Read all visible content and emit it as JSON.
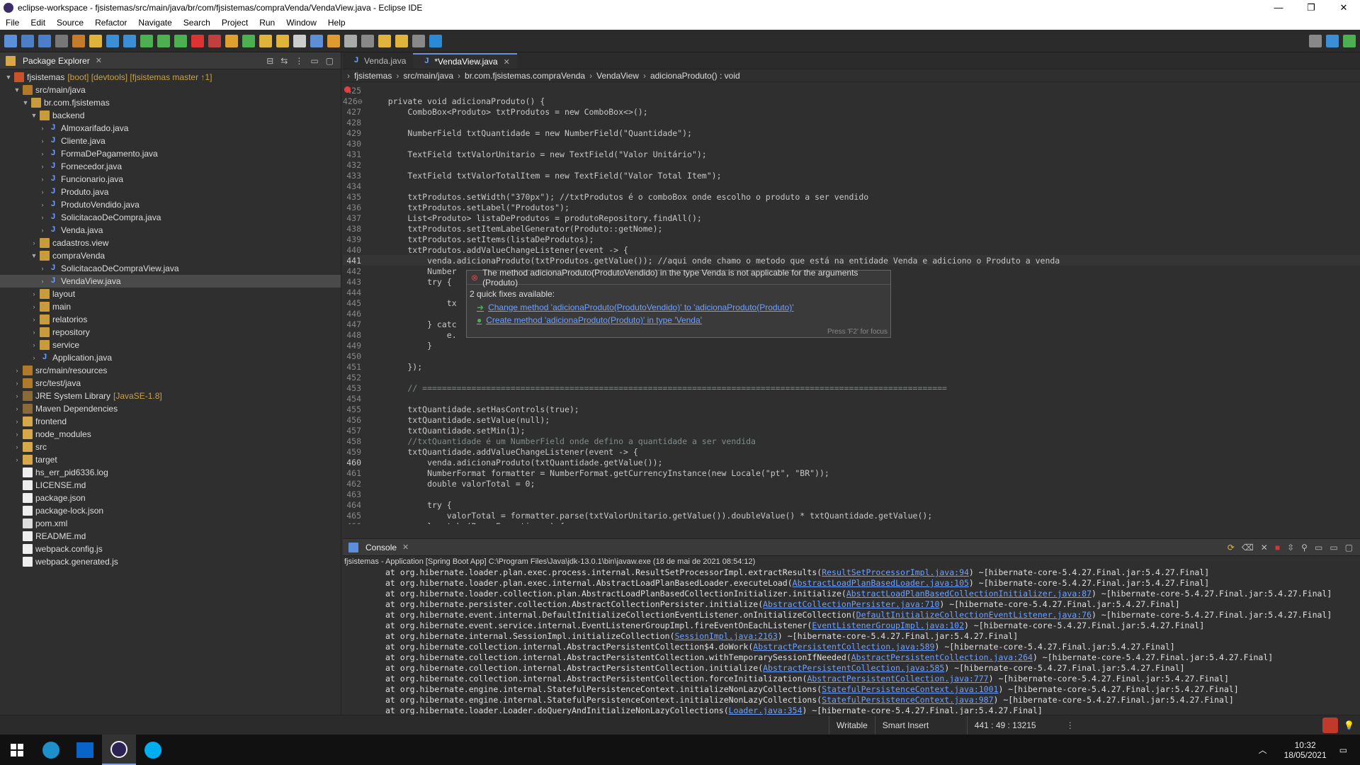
{
  "window": {
    "title": "eclipse-workspace - fjsistemas/src/main/java/br/com/fjsistemas/compraVenda/VendaView.java - Eclipse IDE",
    "minimize": "—",
    "maximize": "❐",
    "close": "✕"
  },
  "menu": [
    "File",
    "Edit",
    "Source",
    "Refactor",
    "Navigate",
    "Search",
    "Project",
    "Run",
    "Window",
    "Help"
  ],
  "explorer": {
    "title": "Package Explorer",
    "items": [
      {
        "label": "fjsistemas",
        "deco": "[boot] [devtools] [fjsistemas master ↑1]"
      },
      {
        "label": "src/main/java"
      },
      {
        "label": "br.com.fjsistemas"
      },
      {
        "label": "backend"
      },
      {
        "label": "Almoxarifado.java"
      },
      {
        "label": "Cliente.java"
      },
      {
        "label": "FormaDePagamento.java"
      },
      {
        "label": "Fornecedor.java"
      },
      {
        "label": "Funcionario.java"
      },
      {
        "label": "Produto.java"
      },
      {
        "label": "ProdutoVendido.java"
      },
      {
        "label": "SolicitacaoDeCompra.java"
      },
      {
        "label": "Venda.java"
      },
      {
        "label": "cadastros.view"
      },
      {
        "label": "compraVenda"
      },
      {
        "label": "SolicitacaoDeCompraView.java"
      },
      {
        "label": "VendaView.java"
      },
      {
        "label": "layout"
      },
      {
        "label": "main"
      },
      {
        "label": "relatorios"
      },
      {
        "label": "repository"
      },
      {
        "label": "service"
      },
      {
        "label": "Application.java"
      },
      {
        "label": "src/main/resources"
      },
      {
        "label": "src/test/java"
      },
      {
        "label": "JRE System Library",
        "deco": "[JavaSE-1.8]"
      },
      {
        "label": "Maven Dependencies"
      },
      {
        "label": "frontend"
      },
      {
        "label": "node_modules"
      },
      {
        "label": "src"
      },
      {
        "label": "target"
      },
      {
        "label": "hs_err_pid6336.log"
      },
      {
        "label": "LICENSE.md"
      },
      {
        "label": "package.json"
      },
      {
        "label": "package-lock.json"
      },
      {
        "label": "pom.xml"
      },
      {
        "label": "README.md"
      },
      {
        "label": "webpack.config.js"
      },
      {
        "label": "webpack.generated.js"
      }
    ]
  },
  "editor": {
    "tabs": [
      {
        "label": "Venda.java"
      },
      {
        "label": "*VendaView.java"
      }
    ],
    "breadcrumb": [
      "fjsistemas",
      "src/main/java",
      "br.com.fjsistemas.compraVenda",
      "VendaView",
      "adicionaProduto() : void"
    ],
    "lines": [
      {
        "n": "425",
        "t": ""
      },
      {
        "n": "426⊖",
        "t": "    private void adicionaProduto() {"
      },
      {
        "n": "427",
        "t": "        ComboBox<Produto> txtProdutos = new ComboBox<>();"
      },
      {
        "n": "428",
        "t": ""
      },
      {
        "n": "429",
        "t": "        NumberField txtQuantidade = new NumberField(\"Quantidade\");"
      },
      {
        "n": "430",
        "t": ""
      },
      {
        "n": "431",
        "t": "        TextField txtValorUnitario = new TextField(\"Valor Unitário\");"
      },
      {
        "n": "432",
        "t": ""
      },
      {
        "n": "433",
        "t": "        TextField txtValorTotalItem = new TextField(\"Valor Total Item\");"
      },
      {
        "n": "434",
        "t": ""
      },
      {
        "n": "435",
        "t": "        txtProdutos.setWidth(\"370px\"); //txtProdutos é o comboBox onde escolho o produto a ser vendido"
      },
      {
        "n": "436",
        "t": "        txtProdutos.setLabel(\"Produtos\");"
      },
      {
        "n": "437",
        "t": "        List<Produto> listaDeProdutos = produtoRepository.findAll();"
      },
      {
        "n": "438",
        "t": "        txtProdutos.setItemLabelGenerator(Produto::getNome);"
      },
      {
        "n": "439",
        "t": "        txtProdutos.setItems(listaDeProdutos);"
      },
      {
        "n": "440",
        "t": "        txtProdutos.addValueChangeListener(event -> {"
      },
      {
        "n": "441",
        "t": "            venda.adicionaProduto(txtProdutos.getValue()); //aqui onde chamo o metodo que está na entidade Venda e adiciono o Produto a venda",
        "err": true
      },
      {
        "n": "442",
        "t": "            Number"
      },
      {
        "n": "443",
        "t": "            try {"
      },
      {
        "n": "444",
        "t": ""
      },
      {
        "n": "445",
        "t": "                tx"
      },
      {
        "n": "446",
        "t": ""
      },
      {
        "n": "447",
        "t": "            } catc"
      },
      {
        "n": "448",
        "t": "                e."
      },
      {
        "n": "449",
        "t": "            }"
      },
      {
        "n": "450",
        "t": ""
      },
      {
        "n": "451",
        "t": "        });"
      },
      {
        "n": "452",
        "t": ""
      },
      {
        "n": "453",
        "t": "        // ==========================================================================================================="
      },
      {
        "n": "454",
        "t": ""
      },
      {
        "n": "455",
        "t": "        txtQuantidade.setHasControls(true);"
      },
      {
        "n": "456",
        "t": "        txtQuantidade.setValue(null);"
      },
      {
        "n": "457",
        "t": "        txtQuantidade.setMin(1);"
      },
      {
        "n": "458",
        "t": "        //txtQuantidade é um NumberField onde defino a quantidade a ser vendida"
      },
      {
        "n": "459",
        "t": "        txtQuantidade.addValueChangeListener(event -> {"
      },
      {
        "n": "460",
        "t": "            venda.adicionaProduto(txtQuantidade.getValue());",
        "err": true
      },
      {
        "n": "461",
        "t": "            NumberFormat formatter = NumberFormat.getCurrencyInstance(new Locale(\"pt\", \"BR\"));"
      },
      {
        "n": "462",
        "t": "            double valorTotal = 0;"
      },
      {
        "n": "463",
        "t": ""
      },
      {
        "n": "464",
        "t": "            try {"
      },
      {
        "n": "465",
        "t": "                valorTotal = formatter.parse(txtValorUnitario.getValue()).doubleValue() * txtQuantidade.getValue();"
      },
      {
        "n": "466",
        "t": "            } catch (ParseException e) {"
      }
    ]
  },
  "hover": {
    "message": "The method adicionaProduto(ProdutoVendido) in the type Venda is not applicable for the arguments (Produto)",
    "fixes_header": "2 quick fixes available:",
    "fixes": [
      "Change method 'adicionaProduto(ProdutoVendido)' to 'adicionaProduto(Produto)'",
      "Create method 'adicionaProduto(Produto)' in type 'Venda'"
    ],
    "footer": "Press 'F2' for focus"
  },
  "console": {
    "title": "Console",
    "info": "fjsistemas - Application [Spring Boot App] C:\\Program Files\\Java\\jdk-13.0.1\\bin\\javaw.exe  (18 de mai de 2021 08:54:12)",
    "lines": [
      {
        "pre": "at org.hibernate.loader.plan.exec.process.internal.ResultSetProcessorImpl.extractResults(",
        "link": "ResultSetProcessorImpl.java:94",
        "post": ") ~[hibernate-core-5.4.27.Final.jar:5.4.27.Final]"
      },
      {
        "pre": "at org.hibernate.loader.plan.exec.internal.AbstractLoadPlanBasedLoader.executeLoad(",
        "link": "AbstractLoadPlanBasedLoader.java:105",
        "post": ") ~[hibernate-core-5.4.27.Final.jar:5.4.27.Final]"
      },
      {
        "pre": "at org.hibernate.loader.collection.plan.AbstractLoadPlanBasedCollectionInitializer.initialize(",
        "link": "AbstractLoadPlanBasedCollectionInitializer.java:87",
        "post": ") ~[hibernate-core-5.4.27.Final.jar:5.4.27.Final]"
      },
      {
        "pre": "at org.hibernate.persister.collection.AbstractCollectionPersister.initialize(",
        "link": "AbstractCollectionPersister.java:710",
        "post": ") ~[hibernate-core-5.4.27.Final.jar:5.4.27.Final]"
      },
      {
        "pre": "at org.hibernate.event.internal.DefaultInitializeCollectionEventListener.onInitializeCollection(",
        "link": "DefaultInitializeCollectionEventListener.java:76",
        "post": ") ~[hibernate-core-5.4.27.Final.jar:5.4.27.Final]"
      },
      {
        "pre": "at org.hibernate.event.service.internal.EventListenerGroupImpl.fireEventOnEachListener(",
        "link": "EventListenerGroupImpl.java:102",
        "post": ") ~[hibernate-core-5.4.27.Final.jar:5.4.27.Final]"
      },
      {
        "pre": "at org.hibernate.internal.SessionImpl.initializeCollection(",
        "link": "SessionImpl.java:2163",
        "post": ") ~[hibernate-core-5.4.27.Final.jar:5.4.27.Final]"
      },
      {
        "pre": "at org.hibernate.collection.internal.AbstractPersistentCollection$4.doWork(",
        "link": "AbstractPersistentCollection.java:589",
        "post": ") ~[hibernate-core-5.4.27.Final.jar:5.4.27.Final]"
      },
      {
        "pre": "at org.hibernate.collection.internal.AbstractPersistentCollection.withTemporarySessionIfNeeded(",
        "link": "AbstractPersistentCollection.java:264",
        "post": ") ~[hibernate-core-5.4.27.Final.jar:5.4.27.Final]"
      },
      {
        "pre": "at org.hibernate.collection.internal.AbstractPersistentCollection.initialize(",
        "link": "AbstractPersistentCollection.java:585",
        "post": ") ~[hibernate-core-5.4.27.Final.jar:5.4.27.Final]"
      },
      {
        "pre": "at org.hibernate.collection.internal.AbstractPersistentCollection.forceInitialization(",
        "link": "AbstractPersistentCollection.java:777",
        "post": ") ~[hibernate-core-5.4.27.Final.jar:5.4.27.Final]"
      },
      {
        "pre": "at org.hibernate.engine.internal.StatefulPersistenceContext.initializeNonLazyCollections(",
        "link": "StatefulPersistenceContext.java:1001",
        "post": ") ~[hibernate-core-5.4.27.Final.jar:5.4.27.Final]"
      },
      {
        "pre": "at org.hibernate.engine.internal.StatefulPersistenceContext.initializeNonLazyCollections(",
        "link": "StatefulPersistenceContext.java:987",
        "post": ") ~[hibernate-core-5.4.27.Final.jar:5.4.27.Final]"
      },
      {
        "pre": "at org.hibernate.loader.Loader.doQueryAndInitializeNonLazyCollections(",
        "link": "Loader.java:354",
        "post": ") ~[hibernate-core-5.4.27.Final.jar:5.4.27.Final]"
      }
    ]
  },
  "status": {
    "writable": "Writable",
    "insert": "Smart Insert",
    "position": "441 : 49 : 13215"
  },
  "taskbar": {
    "time": "10:32",
    "date": "18/05/2021"
  }
}
